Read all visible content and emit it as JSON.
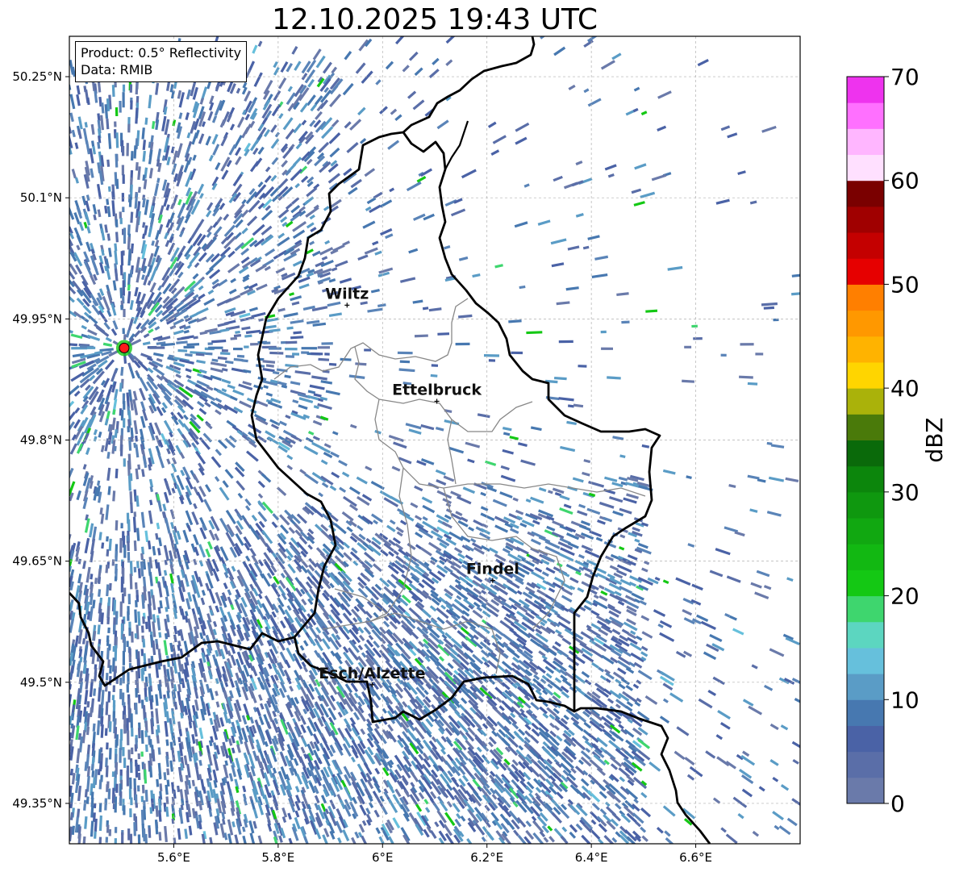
{
  "title": "12.10.2025 19:43 UTC",
  "info": {
    "product": "Product: 0.5° Reflectivity",
    "data": "Data: RMIB"
  },
  "map": {
    "lon_range": [
      5.4,
      6.8
    ],
    "lat_range": [
      49.3,
      50.3
    ],
    "lon_ticks": [
      {
        "value": 5.6,
        "label": "5.6°E"
      },
      {
        "value": 5.8,
        "label": "5.8°E"
      },
      {
        "value": 6.0,
        "label": "6°E"
      },
      {
        "value": 6.2,
        "label": "6.2°E"
      },
      {
        "value": 6.4,
        "label": "6.4°E"
      },
      {
        "value": 6.6,
        "label": "6.6°E"
      }
    ],
    "lat_ticks": [
      {
        "value": 50.25,
        "label": "50.25°N"
      },
      {
        "value": 50.1,
        "label": "50.1°N"
      },
      {
        "value": 49.95,
        "label": "49.95°N"
      },
      {
        "value": 49.8,
        "label": "49.8°N"
      },
      {
        "value": 49.65,
        "label": "49.65°N"
      },
      {
        "value": 49.5,
        "label": "49.5°N"
      },
      {
        "value": 49.35,
        "label": "49.35°N"
      }
    ],
    "radar_site": {
      "lon": 5.505,
      "lat": 49.914,
      "color": "#ff1a1a"
    },
    "cities": [
      {
        "name": "Wiltz",
        "lon": 5.932,
        "lat": 49.967
      },
      {
        "name": "Ettelbruck",
        "lon": 6.104,
        "lat": 49.848
      },
      {
        "name": "Findel",
        "lon": 6.211,
        "lat": 49.626
      },
      {
        "name": "Esch/Alzette",
        "lon": 5.98,
        "lat": 49.497
      }
    ],
    "border_color": "#000000",
    "canton_color": "#888888"
  },
  "colorbar": {
    "label": "dBZ",
    "min": 0,
    "max": 70,
    "ticks": [
      "0",
      "10",
      "20",
      "30",
      "40",
      "50",
      "60",
      "70"
    ],
    "colors": [
      "#6a7aaa",
      "#5a6ea8",
      "#4a62a6",
      "#4778b0",
      "#5a9cc6",
      "#66c0dc",
      "#5cd6c0",
      "#3ed66e",
      "#14c814",
      "#12b812",
      "#11a811",
      "#0f980f",
      "#0c860c",
      "#0a6a0a",
      "#4a7a0a",
      "#aab20a",
      "#ffd500",
      "#ffb300",
      "#ff9800",
      "#ff7f00",
      "#e60000",
      "#c40000",
      "#a00000",
      "#7a0000",
      "#ffe0ff",
      "#ffb6ff",
      "#ff70ff",
      "#ee33ee"
    ]
  }
}
